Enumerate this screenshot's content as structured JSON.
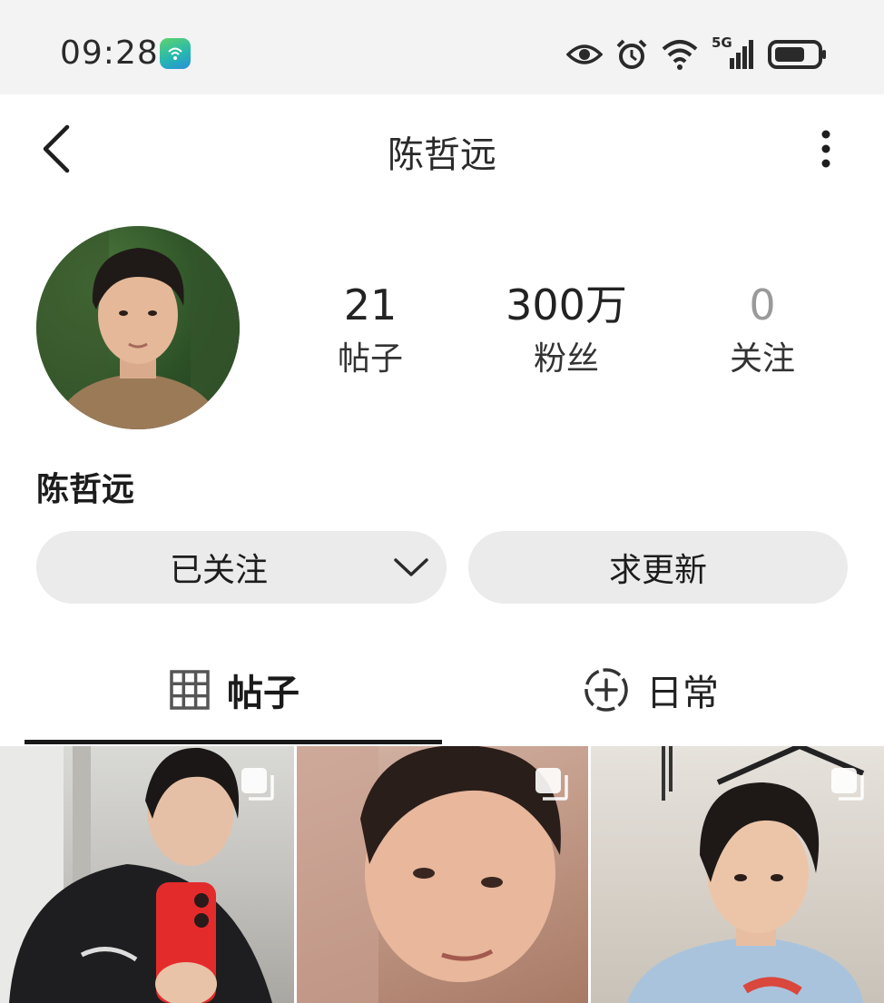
{
  "status_bar": {
    "time": "09:28",
    "network": "5G",
    "icons": [
      "app-notification-icon",
      "eye-icon",
      "alarm-icon",
      "wifi-icon",
      "signal-icon",
      "battery-icon"
    ]
  },
  "header": {
    "title": "陈哲远",
    "back_icon": "chevron-left-icon",
    "more_icon": "more-vertical-icon"
  },
  "profile": {
    "name": "陈哲远",
    "stats": [
      {
        "value": "21",
        "label": "帖子"
      },
      {
        "value": "300万",
        "label": "粉丝"
      },
      {
        "value": "0",
        "label": "关注"
      }
    ]
  },
  "actions": {
    "following_label": "已关注",
    "request_label": "求更新"
  },
  "tabs": [
    {
      "label": "帖子",
      "icon": "grid-icon",
      "active": true
    },
    {
      "label": "日常",
      "icon": "add-circle-icon",
      "active": false
    }
  ],
  "posts_count_visible": 3,
  "colors": {
    "status_bg": "#f3f3f3",
    "button_bg": "#ebebeb",
    "text": "#1a1a1a",
    "muted": "#9a9a9a"
  }
}
